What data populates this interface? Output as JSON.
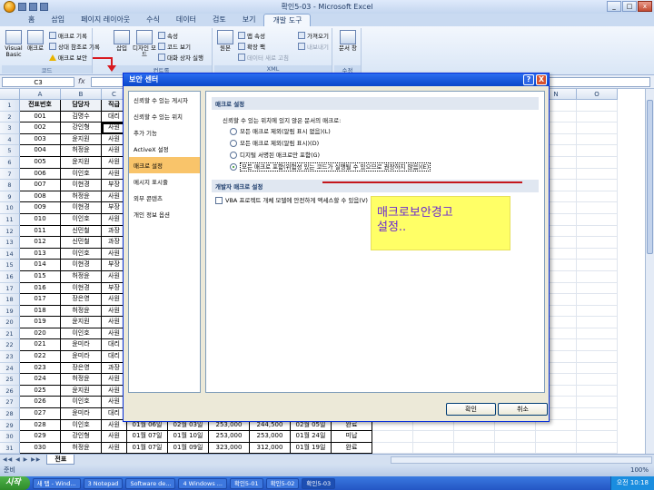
{
  "window": {
    "title": "확인5-03 - Microsoft Excel"
  },
  "tabs": [
    "홈",
    "삽입",
    "페이지 레이아웃",
    "수식",
    "데이터",
    "검토",
    "보기",
    "개발 도구"
  ],
  "ribbon": {
    "code_group": {
      "label": "코드",
      "visual_basic": "Visual Basic",
      "macro": "매크로",
      "record_macro": "매크로 기록",
      "relative_ref": "상대 참조로 기록",
      "macro_security": "매크로 보안"
    },
    "controls_group": {
      "label": "컨트롤",
      "insert": "삽입",
      "design_mode": "디자인 모드",
      "properties": "속성",
      "view_code": "코드 보기",
      "run_dialog": "대화 상자 실행"
    },
    "xml_group": {
      "label": "XML",
      "source": "원본",
      "map_properties": "맵 속성",
      "expansion_packs": "확장 팩",
      "refresh_data": "데이터 새로 고침",
      "import": "가져오기",
      "export": "내보내기"
    },
    "modify_group": {
      "label": "수정",
      "doc_panel": "문서 창"
    }
  },
  "formula_bar": {
    "name_box": "C3"
  },
  "sheet": {
    "columns": [
      "A",
      "B",
      "C",
      "D",
      "E",
      "F",
      "G",
      "H",
      "I",
      "J",
      "K",
      "L",
      "M",
      "N",
      "O"
    ],
    "row_numbers": [
      "1",
      "2",
      "3",
      "4",
      "5",
      "6",
      "7",
      "8",
      "9",
      "10",
      "11",
      "12",
      "13",
      "14",
      "15",
      "16",
      "17",
      "18",
      "19",
      "20",
      "21",
      "22",
      "23",
      "24",
      "25",
      "26",
      "27",
      "28",
      "29",
      "30",
      "31",
      "32"
    ],
    "header_row": [
      "전표번호",
      "담당자",
      "직급"
    ],
    "rows": [
      [
        "001",
        "김명수",
        "대리"
      ],
      [
        "002",
        "강인형",
        "사원"
      ],
      [
        "003",
        "윤지원",
        "사원"
      ],
      [
        "004",
        "허정윤",
        "사원"
      ],
      [
        "005",
        "윤지원",
        "사원"
      ],
      [
        "006",
        "이인호",
        "사원"
      ],
      [
        "007",
        "이현경",
        "부장"
      ],
      [
        "008",
        "허정윤",
        "사원"
      ],
      [
        "009",
        "이현경",
        "부장"
      ],
      [
        "010",
        "이인호",
        "사원"
      ],
      [
        "011",
        "신민철",
        "과장"
      ],
      [
        "012",
        "신민철",
        "과장"
      ],
      [
        "013",
        "이인호",
        "사원"
      ],
      [
        "014",
        "이현경",
        "부장"
      ],
      [
        "015",
        "허정윤",
        "사원"
      ],
      [
        "016",
        "이현경",
        "부장"
      ],
      [
        "017",
        "장은영",
        "사원"
      ],
      [
        "018",
        "허정윤",
        "사원"
      ],
      [
        "019",
        "윤지원",
        "사원"
      ],
      [
        "020",
        "이인호",
        "사원"
      ],
      [
        "021",
        "윤미라",
        "대리"
      ],
      [
        "022",
        "윤미라",
        "대리"
      ],
      [
        "023",
        "장은영",
        "과장"
      ],
      [
        "024",
        "허정윤",
        "사원"
      ],
      [
        "025",
        "윤지원",
        "사원"
      ],
      [
        "026",
        "이인호",
        "사원"
      ],
      [
        "027",
        "윤미라",
        "대리"
      ],
      [
        "028",
        "이인호",
        "사원"
      ],
      [
        "029",
        "강인형",
        "사원"
      ],
      [
        "030",
        "허정윤",
        "사원"
      ]
    ],
    "tail_rows": [
      [
        "01월 06일",
        "02월 03일",
        "253,000",
        "244,500",
        "02월 05일",
        "완료"
      ],
      [
        "01월 07일",
        "01월 10일",
        "253,000",
        "253,000",
        "01월 24일",
        "미납"
      ],
      [
        "01월 07일",
        "01월 09일",
        "323,000",
        "312,000",
        "01월 19일",
        "완료"
      ]
    ],
    "sheet_tab": "전표"
  },
  "status": {
    "text": "준비",
    "zoom": "100%"
  },
  "dialog": {
    "title": "보안 센터",
    "help": "?",
    "close": "X",
    "sidebar": [
      "신뢰할 수 있는 게시자",
      "신뢰할 수 있는 위치",
      "추가 기능",
      "ActiveX 설정",
      "매크로 설정",
      "메시지 표시줄",
      "외부 콘텐츠",
      "개인 정보 옵션"
    ],
    "active_index": 4,
    "macro_section": "매크로 설정",
    "prompt": "신뢰할 수 있는 위치에 있지 않은 문서의 매크로:",
    "options": [
      "모든 매크로 제외(알림 표시 없음)(L)",
      "모든 매크로 제외(알림 표시)(D)",
      "디지털 서명된 매크로만 포함(G)",
      "모든 매크로 포함(위험성 있는 코드가 실행될 수 있으므로 권장하지 않음)(E)"
    ],
    "checked_index": 3,
    "dev_section": "개발자 매크로 설정",
    "vba_check": "VBA 프로젝트 개체 모델에 안전하게 액세스할 수 있음(V)",
    "ok": "확인",
    "cancel": "취소"
  },
  "annotation": {
    "note": "매크로보안경고\n설정.."
  },
  "taskbar": {
    "start": "시작",
    "tasks": [
      "새 탭 - Wind...",
      "3 Notepad",
      "Software de...",
      "4 Windows ...",
      "확인5-01",
      "확인5-02",
      "확인5-03"
    ],
    "active_task": 6,
    "clock": "오전 10:18"
  }
}
